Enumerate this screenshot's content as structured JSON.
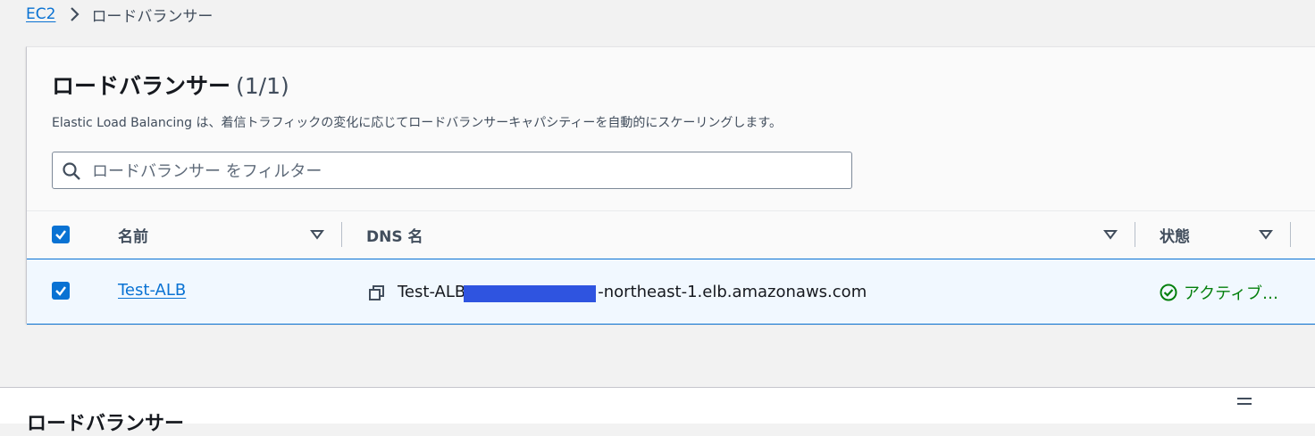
{
  "breadcrumb": {
    "parent": "EC2",
    "current": "ロードバランサー"
  },
  "panel": {
    "title": "ロードバランサー",
    "count": "(1/1)",
    "description": "Elastic Load Balancing は、着信トラフィックの変化に応じてロードバランサーキャパシティーを自動的にスケーリングします。"
  },
  "search": {
    "placeholder": "ロードバランサー をフィルター",
    "value": ""
  },
  "table": {
    "columns": [
      "名前",
      "DNS 名",
      "状態"
    ],
    "rows": [
      {
        "selected": true,
        "name": "Test-ALB",
        "dns_prefix": "Test-ALB",
        "dns_suffix": "-northeast-1.elb.amazonaws.com",
        "status": "アクティブ…"
      }
    ]
  },
  "lower_panel": {
    "title": "ロードバランサー"
  },
  "colors": {
    "link": "#0972d3",
    "status_active": "#037f0c",
    "selected_row_bg": "#f1f8ff"
  },
  "icons": [
    "chevron-right-icon",
    "search-icon",
    "sort-caret-icon",
    "checkbox-checked-icon",
    "copy-icon",
    "status-success-icon",
    "drag-handle-icon"
  ]
}
